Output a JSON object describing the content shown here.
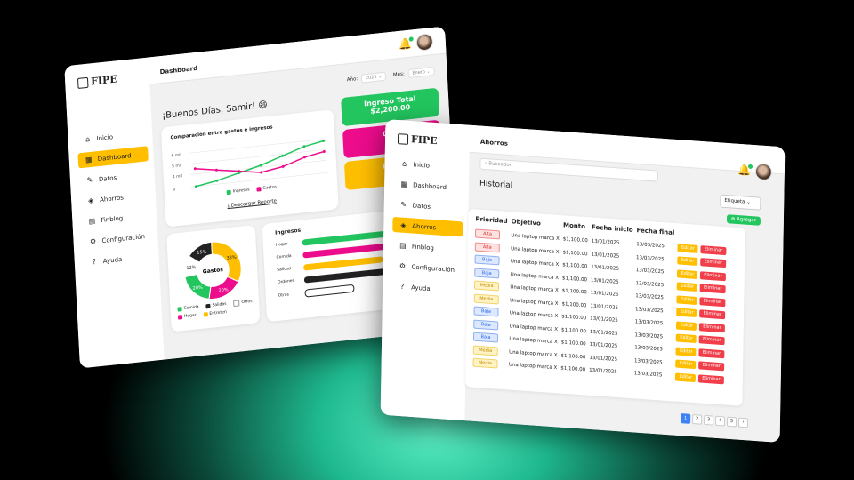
{
  "left": {
    "brand": "FIPE",
    "nav": [
      {
        "icon": "home-icon",
        "glyph": "⌂",
        "label": "Inicio"
      },
      {
        "icon": "dashboard-icon",
        "glyph": "▦",
        "label": "Dashboard"
      },
      {
        "icon": "pencil-icon",
        "glyph": "✎",
        "label": "Datos"
      },
      {
        "icon": "piggy-icon",
        "glyph": "◈",
        "label": "Ahorros"
      },
      {
        "icon": "book-icon",
        "glyph": "▤",
        "label": "Finblog"
      },
      {
        "icon": "gear-icon",
        "glyph": "⚙",
        "label": "Configuración"
      },
      {
        "icon": "help-icon",
        "glyph": "?",
        "label": "Ayuda"
      }
    ],
    "page_title": "Dashboard",
    "greeting": "¡Buenos Días, Samir!",
    "filter": {
      "year_label": "Año:",
      "year_value": "2025",
      "month_label": "Mes:",
      "month_value": "Enero"
    },
    "line_card": {
      "title": "Comparación entre gastos e ingresos",
      "y_ticks": [
        "6 mil",
        "5 mil",
        "4 mil",
        "0"
      ],
      "legend": [
        "Ingresos",
        "Gastos"
      ],
      "download": "Descargar Reporte"
    },
    "totals": [
      {
        "label": "Ingreso Total",
        "value": "$2,200.00",
        "color": "#22c55e"
      },
      {
        "label": "Gast",
        "value": "$4",
        "color": "#ec0c8c"
      },
      {
        "label": "Diner",
        "value": "$",
        "color": "#ffbf00"
      }
    ],
    "donut": {
      "center": "Gastos",
      "slices": [
        {
          "name": "Comida",
          "pct": 20,
          "color": "#22c55e",
          "label": "20%"
        },
        {
          "name": "Hogar",
          "pct": 20,
          "color": "#ec0c8c",
          "label": "20%"
        },
        {
          "name": "Entretenim",
          "pct": 33,
          "color": "#ffbf00",
          "label": "33%"
        },
        {
          "name": "Salidas",
          "pct": 15,
          "color": "#222222",
          "label": "15%"
        },
        {
          "name": "Otros",
          "pct": 12,
          "color": "#ffffff",
          "label": "12%"
        }
      ],
      "legend": [
        {
          "name": "Comida",
          "color": "#22c55e"
        },
        {
          "name": "Salidas",
          "color": "#222222"
        },
        {
          "name": "Otros",
          "color": "#ffffff"
        },
        {
          "name": "Hogar",
          "color": "#ec0c8c"
        },
        {
          "name": "Entreten",
          "color": "#ffbf00"
        }
      ]
    },
    "ingresos": {
      "title": "Ingresos",
      "rows": [
        {
          "label": "Hogar",
          "pct": 0.85,
          "color": "#22c55e"
        },
        {
          "label": "Comida",
          "pct": 0.8,
          "color": "#ec0c8c"
        },
        {
          "label": "Salidas",
          "pct": 0.5,
          "color": "#ffbf00"
        },
        {
          "label": "Ordenes",
          "pct": 0.75,
          "color": "#222222"
        },
        {
          "label": "Otros",
          "pct": 0.3,
          "color": "#ffffff"
        }
      ]
    }
  },
  "right": {
    "brand": "FIPE",
    "nav": [
      {
        "icon": "home-icon",
        "glyph": "⌂",
        "label": "Inicio"
      },
      {
        "icon": "dashboard-icon",
        "glyph": "▦",
        "label": "Dashboard"
      },
      {
        "icon": "pencil-icon",
        "glyph": "✎",
        "label": "Datos"
      },
      {
        "icon": "piggy-icon",
        "glyph": "◈",
        "label": "Ahorros"
      },
      {
        "icon": "book-icon",
        "glyph": "▤",
        "label": "Finblog"
      },
      {
        "icon": "gear-icon",
        "glyph": "⚙",
        "label": "Configuración"
      },
      {
        "icon": "help-icon",
        "glyph": "?",
        "label": "Ayuda"
      }
    ],
    "page_title": "Ahorros",
    "search_placeholder": "Buscador",
    "section_title": "Historial",
    "filter_label": "Etiqueta",
    "add_button": "Agregar",
    "columns": [
      "Prioridad",
      "Objetivo",
      "Monto",
      "Fecha inicio",
      "Fecha final"
    ],
    "rows": [
      {
        "prio": "Alta",
        "obj": "Una laptop marca X",
        "monto": "$1,100.00",
        "ini": "13/01/2025",
        "fin": "13/03/2025"
      },
      {
        "prio": "Alta",
        "obj": "Una laptop marca X",
        "monto": "$1,100.00",
        "ini": "13/01/2025",
        "fin": "13/03/2025"
      },
      {
        "prio": "Baja",
        "obj": "Una laptop marca X",
        "monto": "$1,100.00",
        "ini": "13/01/2025",
        "fin": "13/03/2025"
      },
      {
        "prio": "Baja",
        "obj": "Una laptop marca X",
        "monto": "$1,100.00",
        "ini": "13/01/2025",
        "fin": "13/03/2025"
      },
      {
        "prio": "Media",
        "obj": "Una laptop marca X",
        "monto": "$1,100.00",
        "ini": "13/01/2025",
        "fin": "13/03/2025"
      },
      {
        "prio": "Media",
        "obj": "Una laptop marca X",
        "monto": "$1,100.00",
        "ini": "13/01/2025",
        "fin": "13/03/2025"
      },
      {
        "prio": "Baja",
        "obj": "Una laptop marca X",
        "monto": "$1,100.00",
        "ini": "13/01/2025",
        "fin": "13/03/2025"
      },
      {
        "prio": "Baja",
        "obj": "Una laptop marca X",
        "monto": "$1,100.00",
        "ini": "13/01/2025",
        "fin": "13/03/2025"
      },
      {
        "prio": "Baja",
        "obj": "Una laptop marca X",
        "monto": "$1,100.00",
        "ini": "13/01/2025",
        "fin": "13/03/2025"
      },
      {
        "prio": "Media",
        "obj": "Una laptop marca X",
        "monto": "$1,100.00",
        "ini": "13/01/2025",
        "fin": "13/03/2025"
      },
      {
        "prio": "Media",
        "obj": "Una laptop marca X",
        "monto": "$1,100.00",
        "ini": "13/01/2025",
        "fin": "13/03/2025"
      }
    ],
    "edit_label": "Editar",
    "delete_label": "Eliminar",
    "prio_colors": {
      "Alta": {
        "bg": "#fde2e2",
        "fg": "#e02424",
        "border": "#f08a8a"
      },
      "Baja": {
        "bg": "#dbe8ff",
        "fg": "#2563eb",
        "border": "#8fb0f0"
      },
      "Media": {
        "bg": "#fff3c4",
        "fg": "#c08a00",
        "border": "#f2d46a"
      }
    },
    "pages": [
      "1",
      "2",
      "3",
      "4",
      "5",
      "›"
    ]
  }
}
